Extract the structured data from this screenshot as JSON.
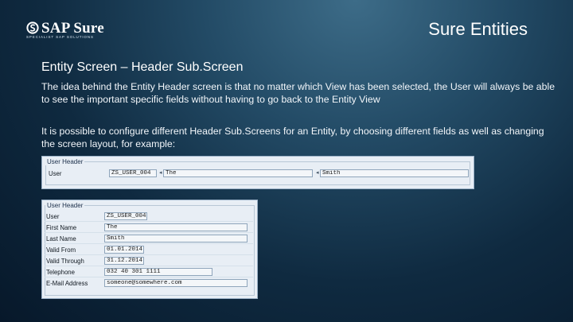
{
  "logo": {
    "brand": "SAP Sure",
    "tagline": "SPECIALIST SAP SOLUTIONS",
    "mark_icon": "sap-sure-logo-icon"
  },
  "slide_title": "Sure Entities",
  "section_heading": "Entity Screen – Header Sub.Screen",
  "paragraphs": [
    "The idea behind the Entity Header screen is that no matter which View has been selected, the User will always be able to see the important specific fields without having to go back to the Entity View",
    "It is possible to configure different Header Sub.Screens for an Entity, by choosing different fields as well as changing the screen layout, for example:"
  ],
  "example1": {
    "title": "User Header",
    "label": "User",
    "fields": [
      "ZS_USER_004",
      "The",
      "Smith"
    ]
  },
  "example2": {
    "title": "User Header",
    "rows": [
      {
        "label": "User",
        "value": "ZS_USER_004"
      },
      {
        "label": "First Name",
        "value": "The"
      },
      {
        "label": "Last Name",
        "value": "Smith"
      },
      {
        "label": "Valid From",
        "value": "01.01.2014"
      },
      {
        "label": "Valid Through",
        "value": "31.12.2014"
      },
      {
        "label": "Telephone",
        "value": "032 40 301 1111"
      },
      {
        "label": "E-Mail Address",
        "value": "someone@somewhere.com"
      }
    ]
  },
  "colors": {
    "background": "#0f2a40",
    "text": "#ffffff",
    "sap_panel": "#e8eef5"
  }
}
